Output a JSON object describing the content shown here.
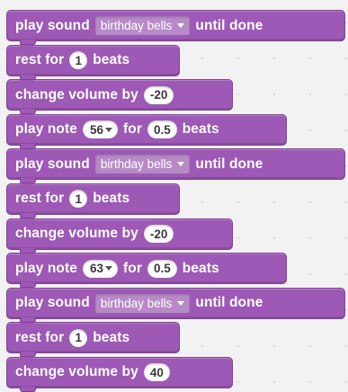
{
  "colors": {
    "block": "#9d59b5",
    "block_border": "#7f3f95",
    "dropdown": "#b78ac7",
    "workspace": "#f2f2f2"
  },
  "script": [
    {
      "kind": "play_sound",
      "text1": "play sound",
      "sound": "birthday bells",
      "text2": "until done"
    },
    {
      "kind": "rest",
      "text1": "rest for",
      "beats": "1",
      "text2": "beats"
    },
    {
      "kind": "change_volume",
      "text1": "change volume by",
      "value": "-20"
    },
    {
      "kind": "play_note",
      "text1": "play note",
      "note": "56",
      "text2": "for",
      "beats": "0.5",
      "text3": "beats"
    },
    {
      "kind": "play_sound",
      "text1": "play sound",
      "sound": "birthday bells",
      "text2": "until done"
    },
    {
      "kind": "rest",
      "text1": "rest for",
      "beats": "1",
      "text2": "beats"
    },
    {
      "kind": "change_volume",
      "text1": "change volume by",
      "value": "-20"
    },
    {
      "kind": "play_note",
      "text1": "play note",
      "note": "63",
      "text2": "for",
      "beats": "0.5",
      "text3": "beats"
    },
    {
      "kind": "play_sound",
      "text1": "play sound",
      "sound": "birthday bells",
      "text2": "until done"
    },
    {
      "kind": "rest",
      "text1": "rest for",
      "beats": "1",
      "text2": "beats"
    },
    {
      "kind": "change_volume",
      "text1": "change volume by",
      "value": "40"
    }
  ]
}
